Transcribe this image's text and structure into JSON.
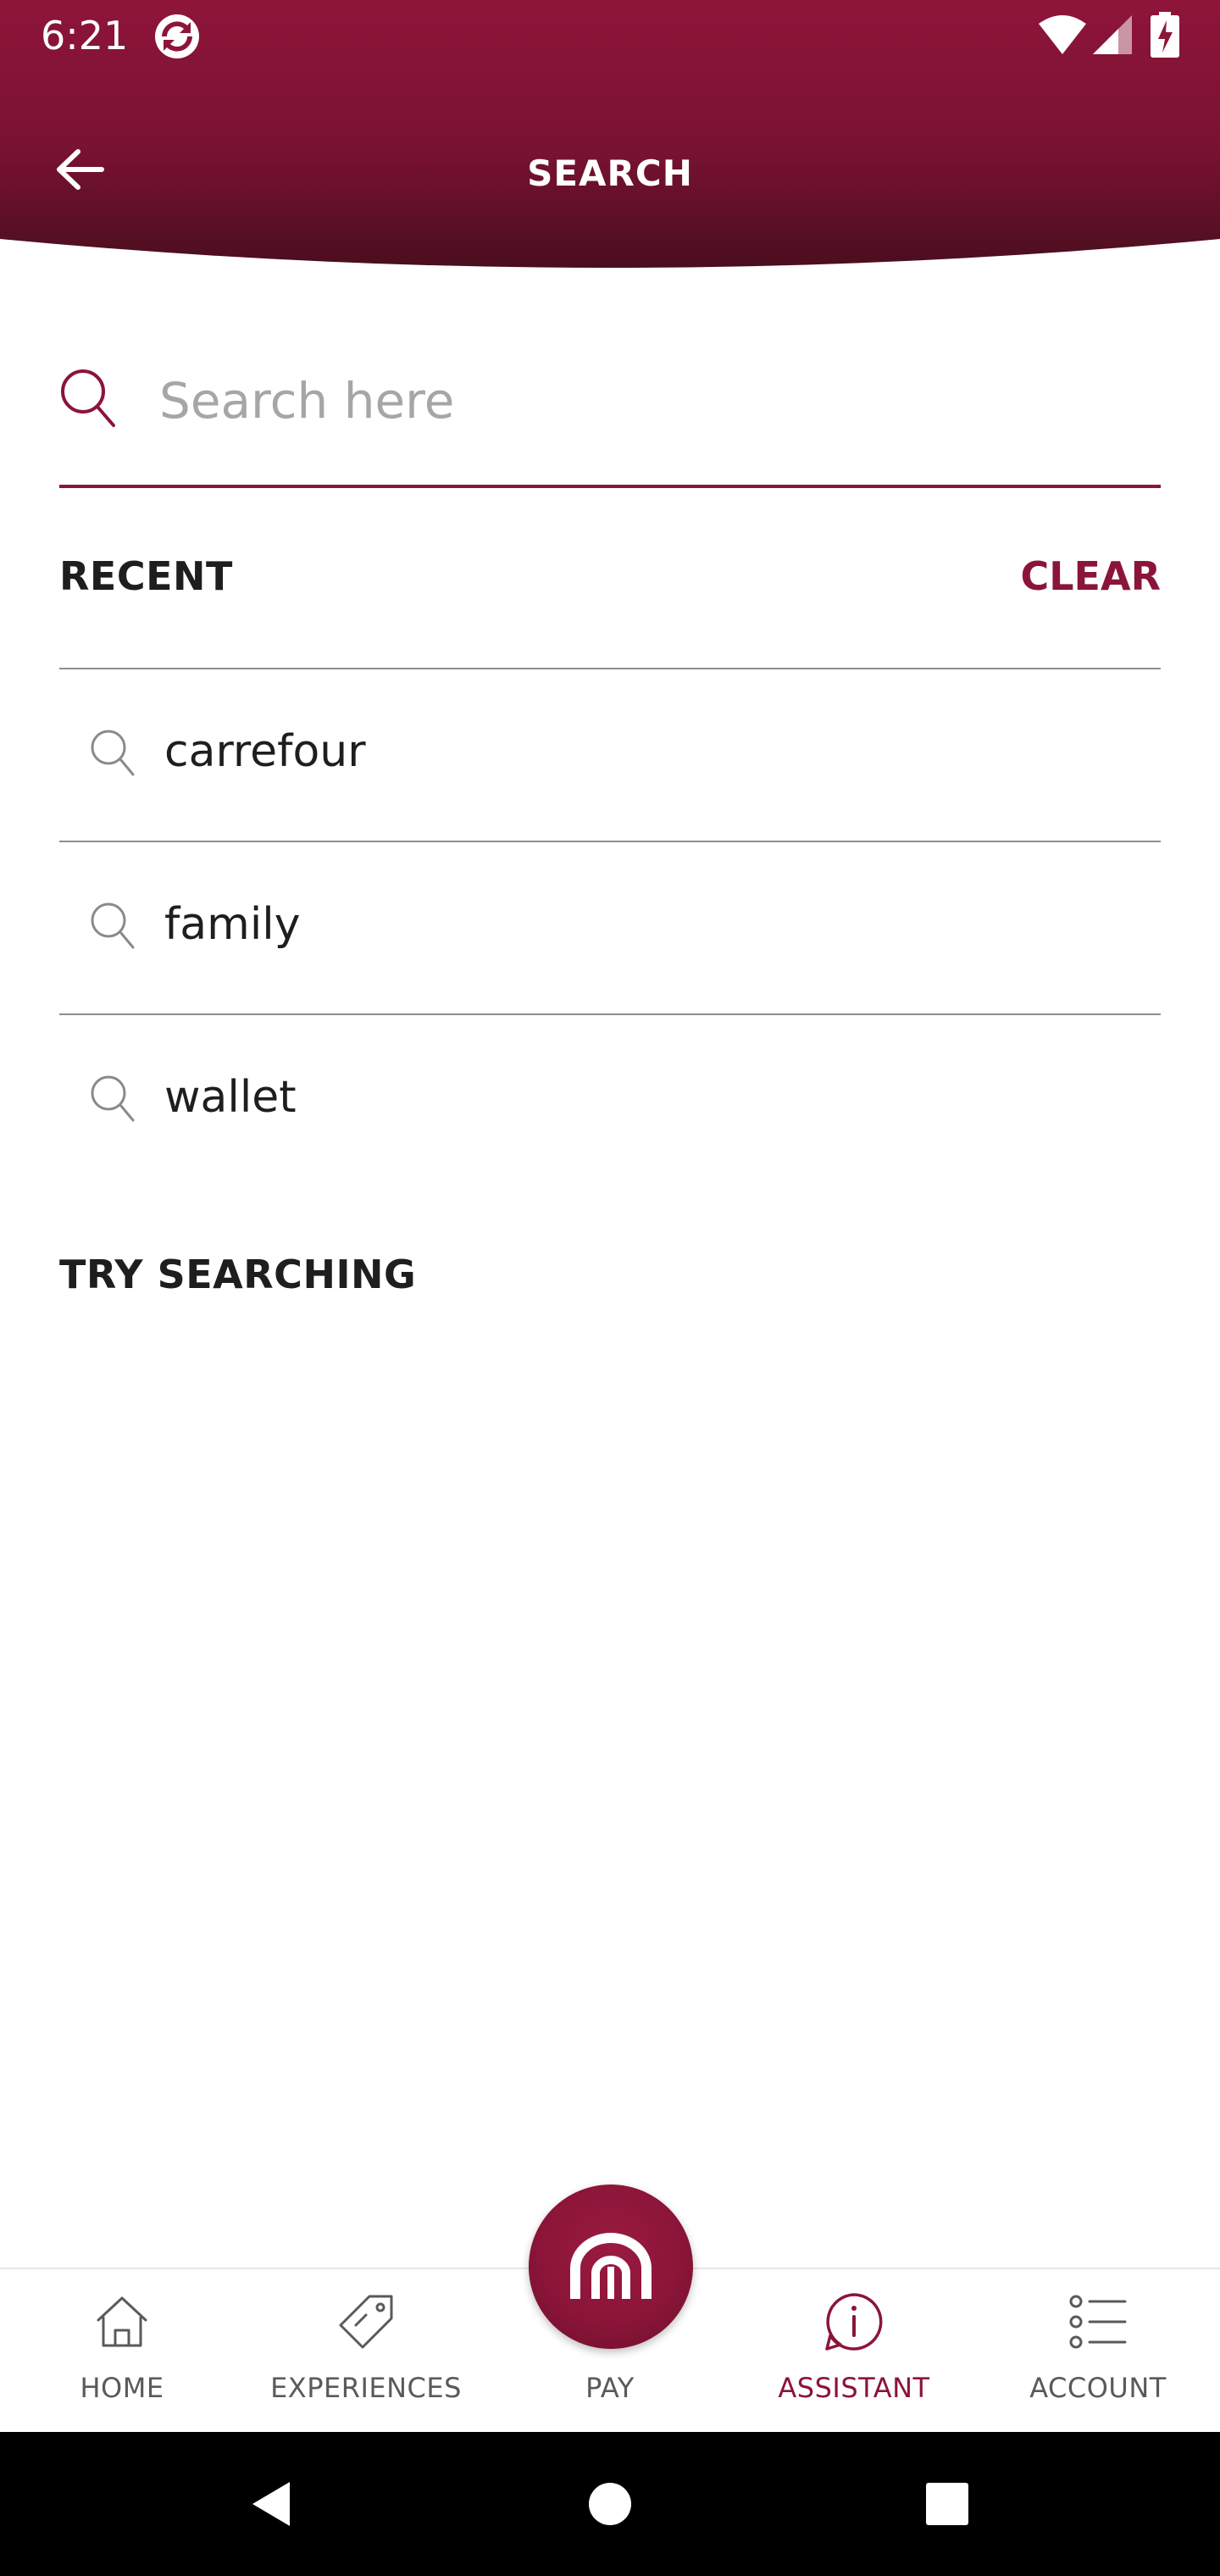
{
  "status_bar": {
    "time": "6:21"
  },
  "header": {
    "title": "SEARCH",
    "back_icon": "arrow-left-icon",
    "background_colors": [
      "#8e1539",
      "#4a0e1f"
    ]
  },
  "search": {
    "placeholder": "Search here",
    "value": "",
    "icon": "search-icon",
    "accent_color": "#8b1538"
  },
  "recent": {
    "heading": "RECENT",
    "clear_label": "CLEAR",
    "items": [
      {
        "label": "carrefour"
      },
      {
        "label": "family"
      },
      {
        "label": "wallet"
      }
    ]
  },
  "try_searching": {
    "heading": "TRY SEARCHING"
  },
  "bottom_nav": {
    "active": "ASSISTANT",
    "items": [
      {
        "label": "HOME",
        "icon": "home-icon"
      },
      {
        "label": "EXPERIENCES",
        "icon": "tag-icon"
      },
      {
        "label": "PAY",
        "icon": "pay-logo-icon"
      },
      {
        "label": "ASSISTANT",
        "icon": "info-bubble-icon"
      },
      {
        "label": "ACCOUNT",
        "icon": "list-icon"
      }
    ]
  },
  "system_nav": {
    "buttons": [
      "back-triangle-icon",
      "home-circle-icon",
      "recents-square-icon"
    ]
  }
}
